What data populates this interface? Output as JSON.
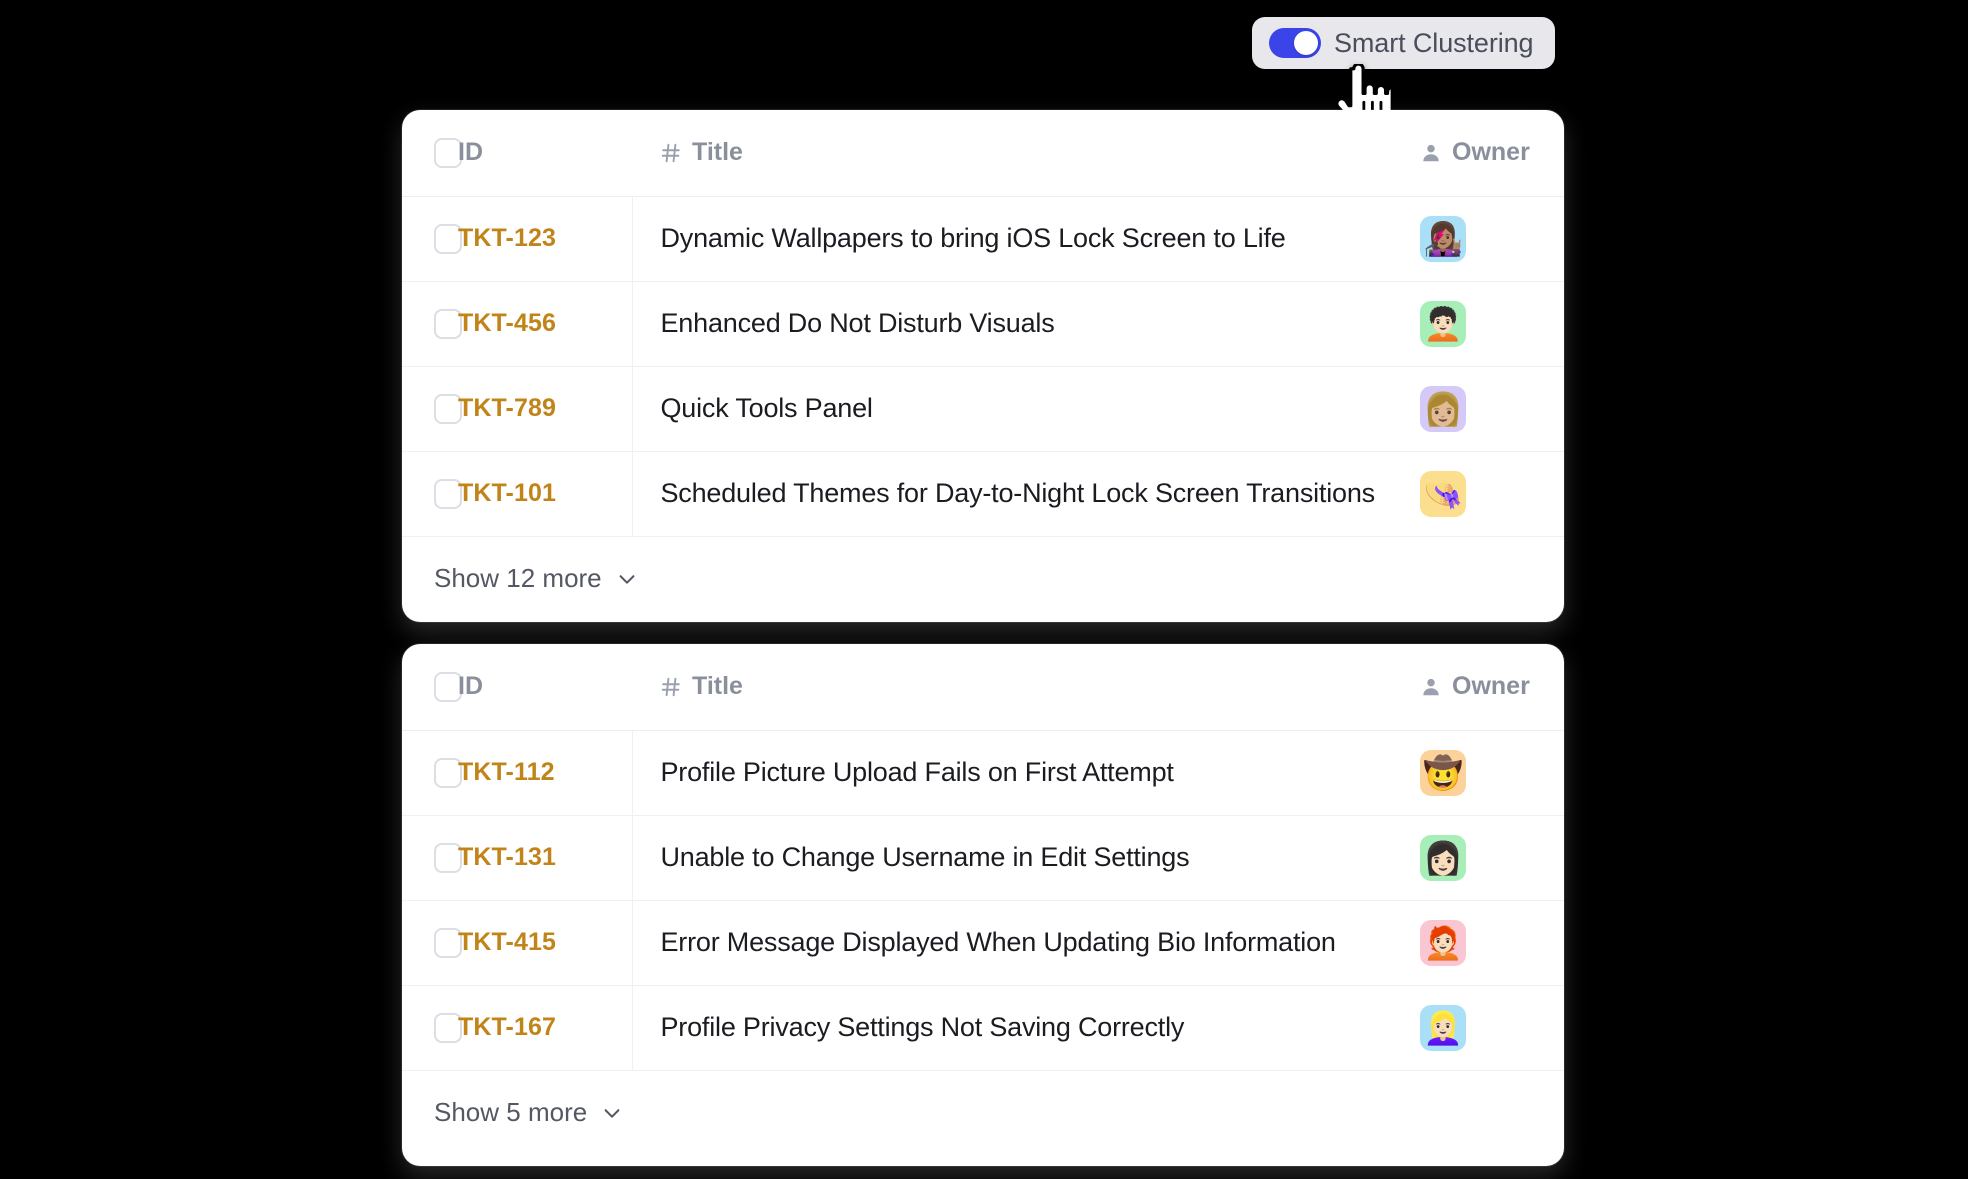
{
  "toggle": {
    "label": "Smart Clustering",
    "state": "on",
    "accent_color": "#3b44e8",
    "pill_bg": "#e8e8ec"
  },
  "cursor": {
    "icon": "pointing-hand-cursor"
  },
  "columns": {
    "id": "ID",
    "title": "Title",
    "owner": "Owner",
    "title_icon": "hash-icon",
    "owner_icon": "person-icon"
  },
  "accent": {
    "ticket_id_color": "#c08419",
    "title_color": "#1a1c21",
    "header_color": "#8a8f9c"
  },
  "tables": [
    {
      "name": "feature-requests-cluster",
      "rows": [
        {
          "id": "TKT-123",
          "title": "Dynamic Wallpapers to bring iOS Lock Screen to Life",
          "owner_avatar": "👩🏽‍🎤",
          "owner_bg": "#a9e0f7"
        },
        {
          "id": "TKT-456",
          "title": "Enhanced Do Not Disturb Visuals",
          "owner_avatar": "🧑🏻‍🦱",
          "owner_bg": "#a8eeb8"
        },
        {
          "id": "TKT-789",
          "title": "Quick Tools Panel",
          "owner_avatar": "👩🏼",
          "owner_bg": "#d5c9f7"
        },
        {
          "id": "TKT-101",
          "title": "Scheduled Themes for Day-to-Night Lock Screen Transitions",
          "owner_avatar": "👒",
          "owner_bg": "#fbdf8e"
        }
      ],
      "show_more_label": "Show 12 more",
      "show_more_count": 12
    },
    {
      "name": "profile-bugs-cluster",
      "rows": [
        {
          "id": "TKT-112",
          "title": "Profile Picture Upload Fails on First Attempt",
          "owner_avatar": "🤠",
          "owner_bg": "#fbd29a"
        },
        {
          "id": "TKT-131",
          "title": "Unable to Change Username in Edit Settings",
          "owner_avatar": "👩🏻",
          "owner_bg": "#a8eeb8"
        },
        {
          "id": "TKT-415",
          "title": "Error Message Displayed When Updating Bio Information",
          "owner_avatar": "🧑🏻‍🦰",
          "owner_bg": "#f9c6d2"
        },
        {
          "id": "TKT-167",
          "title": "Profile Privacy Settings Not Saving Correctly",
          "owner_avatar": "👱🏻‍♀️",
          "owner_bg": "#a9e0f7"
        }
      ],
      "show_more_label": "Show 5 more",
      "show_more_count": 5
    }
  ]
}
